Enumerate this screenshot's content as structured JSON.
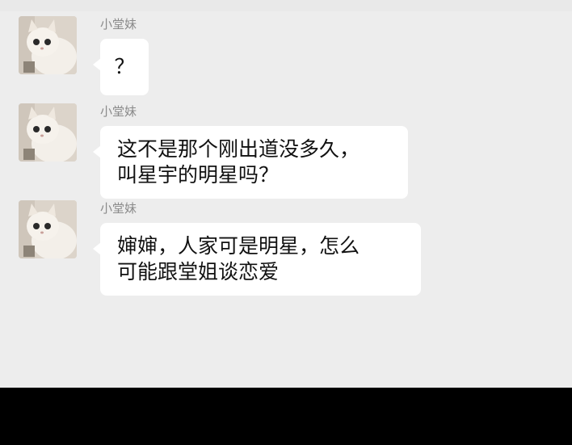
{
  "conversation": {
    "messages": [
      {
        "sender": "小堂妹",
        "avatar": "cat-avatar",
        "text": "？"
      },
      {
        "sender": "小堂妹",
        "avatar": "cat-avatar",
        "text": "这不是那个刚出道没多久，\n叫星宇的明星吗？"
      },
      {
        "sender": "小堂妹",
        "avatar": "cat-avatar",
        "text": "婶婶，人家可是明星，怎么\n可能跟堂姐谈恋爱"
      }
    ]
  },
  "colors": {
    "chat_background": "#ededed",
    "bubble_background": "#ffffff",
    "sender_text": "#8a8a8a",
    "message_text": "#111111",
    "bottom_bar": "#000000"
  }
}
